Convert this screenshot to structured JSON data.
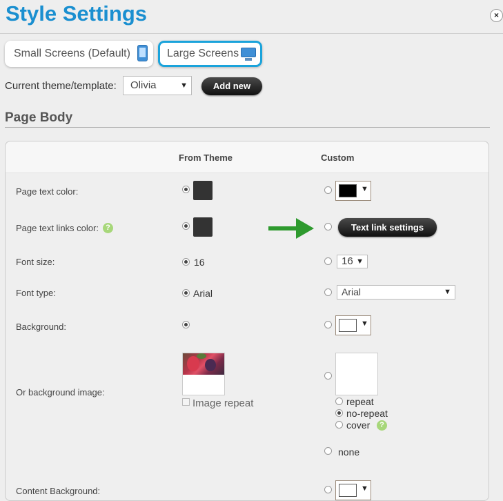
{
  "header": {
    "title": "Style Settings",
    "close_glyph": "×"
  },
  "screen_tabs": [
    {
      "label": "Small Screens (Default)",
      "icon": "phone-icon",
      "selected": false
    },
    {
      "label": "Large Screens",
      "icon": "monitor-icon",
      "selected": true
    }
  ],
  "theme": {
    "label": "Current theme/template:",
    "value": "Olivia",
    "add_label": "Add new"
  },
  "section": {
    "title": "Page Body"
  },
  "columns": {
    "from_theme": "From Theme",
    "custom": "Custom"
  },
  "rows": {
    "page_text_color": {
      "label": "Page text color:",
      "theme_color": "#333333",
      "custom_color": "#000000"
    },
    "page_text_links": {
      "label": "Page text links color:",
      "theme_color": "#333333",
      "button_label": "Text link settings"
    },
    "font_size": {
      "label": "Font size:",
      "theme_value": "16",
      "custom_value": "16"
    },
    "font_type": {
      "label": "Font type:",
      "theme_value": "Arial",
      "custom_value": "Arial"
    },
    "background": {
      "label": "Background:",
      "custom_color": "#ffffff"
    },
    "bg_image": {
      "label": "Or background image:",
      "image_repeat_label": "Image repeat",
      "repeat_options": [
        {
          "label": "repeat",
          "checked": false
        },
        {
          "label": "no-repeat",
          "checked": true
        },
        {
          "label": "cover",
          "checked": false
        }
      ],
      "none_label": "none"
    },
    "content_background": {
      "label": "Content Background:"
    }
  },
  "colors": {
    "accent": "#1a8fd0",
    "tab_border": "#1aa3db",
    "arrow": "#2e9a2e",
    "help": "#a7d77a"
  }
}
